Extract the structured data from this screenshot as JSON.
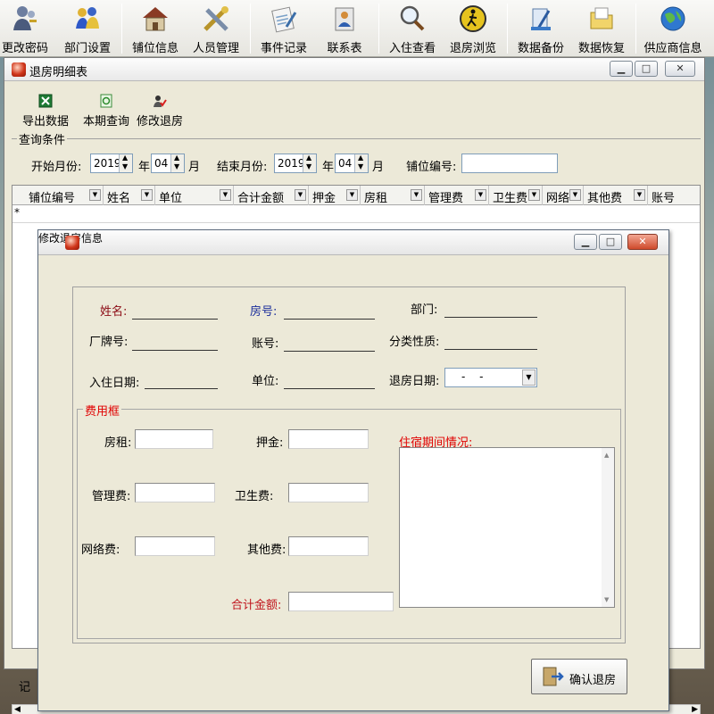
{
  "toolbar": {
    "items": [
      {
        "label": "更改密码",
        "icon": "users-keys-icon"
      },
      {
        "label": "部门设置",
        "icon": "people-group-icon"
      },
      {
        "label": "铺位信息",
        "icon": "house-icon"
      },
      {
        "label": "人员管理",
        "icon": "tools-cross-icon"
      },
      {
        "label": "事件记录",
        "icon": "notepad-pen-icon"
      },
      {
        "label": "联系表",
        "icon": "contact-card-icon"
      },
      {
        "label": "入住查看",
        "icon": "magnifier-icon"
      },
      {
        "label": "退房浏览",
        "icon": "walk-sign-icon"
      },
      {
        "label": "数据备份",
        "icon": "backup-pen-icon"
      },
      {
        "label": "数据恢复",
        "icon": "restore-folder-icon"
      },
      {
        "label": "供应商信息",
        "icon": "globe-icon"
      }
    ]
  },
  "back_window": {
    "title": "退房明细表",
    "tools": {
      "export": "导出数据",
      "current": "本期查询",
      "edit": "修改退房"
    },
    "query": {
      "legend": "查询条件",
      "start_label": "开始月份:",
      "start_year": "2019",
      "year_char_1": "年",
      "start_month": "04",
      "month_char_1": "月",
      "end_label": "结束月份:",
      "end_year": "2019",
      "year_char_2": "年",
      "end_month": "04",
      "month_char_2": "月",
      "stall_label": "铺位编号:",
      "stall_value": ""
    },
    "grid": {
      "columns": [
        "铺位编号",
        "姓名",
        "单位",
        "合计金额",
        "押金",
        "房租",
        "管理费",
        "卫生费",
        "网络",
        "其他费",
        "账号"
      ],
      "new_row_marker": "*"
    },
    "status_text": "记"
  },
  "dialog": {
    "title": "修改退房信息",
    "fields": {
      "name_label": "姓名:",
      "room_label": "房号:",
      "dept_label": "部门:",
      "badge_label": "厂牌号:",
      "account_label": "账号:",
      "category_label": "分类性质:",
      "checkin_label": "入住日期:",
      "unit_label": "单位:",
      "checkout_label": "退房日期:",
      "checkout_value": "- -"
    },
    "fees": {
      "legend": "费用框",
      "rent_label": "房租:",
      "deposit_label": "押金:",
      "mgmt_label": "管理费:",
      "hygiene_label": "卫生费:",
      "network_label": "网络费:",
      "other_label": "其他费:",
      "total_label": "合计金额:",
      "stay_label": "住宿期间情况:"
    },
    "confirm_label": "确认退房"
  },
  "colors": {
    "label_red": "#c0141c",
    "label_dark_red": "#8b0a14",
    "label_blue": "#1a2d9a",
    "legend_red": "#e00000"
  }
}
